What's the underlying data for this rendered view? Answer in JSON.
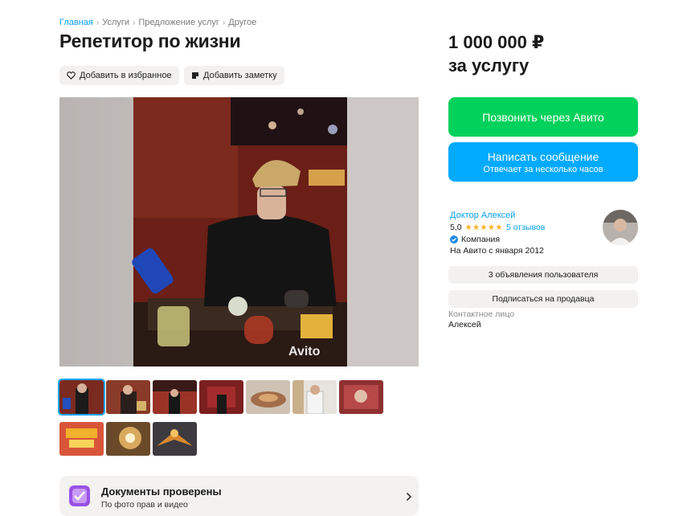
{
  "breadcrumbs": [
    "Главная",
    "Услуги",
    "Предложение услуг",
    "Другое"
  ],
  "breadcrumb_separator": "›",
  "title": "Репетитор по жизни",
  "actions": {
    "favorite": "Добавить в избранное",
    "note": "Добавить заметку"
  },
  "gallery": {
    "watermark": "Avito",
    "thumbnail_count": 10,
    "selected_index": 0
  },
  "price": {
    "amount": "1 000 000 ₽",
    "unit": "за услугу"
  },
  "buttons": {
    "call": "Позвонить через Авито",
    "message": "Написать сообщение",
    "message_sub": "Отвечает за несколько часов"
  },
  "seller": {
    "name": "Доктор Алексей",
    "rating": "5,0",
    "stars": "★★★★★",
    "reviews": "5 отзывов",
    "type": "Компания",
    "since": "На Авито с января 2012",
    "listings_button": "3 объявления пользователя",
    "subscribe_button": "Подписаться на продавца",
    "contact_label": "Контактное лицо",
    "contact_name": "Алексей"
  },
  "documents": {
    "title": "Документы проверены",
    "subtitle": "По фото прав и видео"
  },
  "colors": {
    "green": "#02d15c",
    "blue": "#00aaff",
    "link": "#0aa0f0",
    "star": "#ffb021"
  }
}
